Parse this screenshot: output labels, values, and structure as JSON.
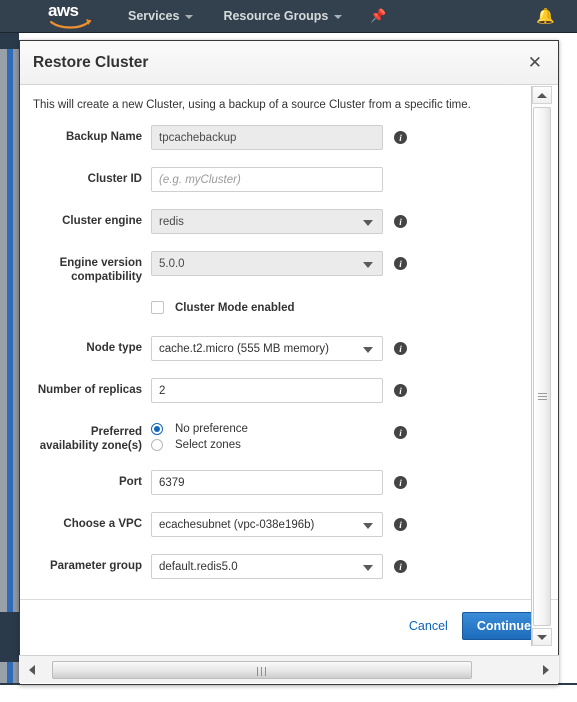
{
  "nav": {
    "logo_text": "aws",
    "logo_name": "aws-logo",
    "services_label": "Services",
    "resource_groups_label": "Resource Groups",
    "pin_icon": "pin-icon",
    "bell_icon": "bell-icon"
  },
  "modal": {
    "title": "Restore Cluster",
    "close_label": "✕",
    "intro": "This will create a new Cluster, using a backup of a source Cluster from a specific time."
  },
  "form": {
    "backup_name": {
      "label": "Backup Name",
      "value": "tpcachebackup",
      "disabled": true
    },
    "cluster_id": {
      "label": "Cluster ID",
      "value": "",
      "placeholder": "(e.g. myCluster)"
    },
    "cluster_engine": {
      "label": "Cluster engine",
      "value": "redis",
      "disabled": true
    },
    "engine_version": {
      "label_line1": "Engine version",
      "label_line2": "compatibility",
      "value": "5.0.0",
      "disabled": true
    },
    "cluster_mode": {
      "label": "Cluster Mode enabled",
      "checked": false
    },
    "node_type": {
      "label": "Node type",
      "value": "cache.t2.micro (555 MB memory)"
    },
    "replicas": {
      "label": "Number of replicas",
      "value": "2"
    },
    "availability_zones": {
      "label_line1": "Preferred",
      "label_line2": "availability zone(s)",
      "option_no_preference": "No preference",
      "option_select_zones": "Select zones",
      "selected": "No preference"
    },
    "port": {
      "label": "Port",
      "value": "6379"
    },
    "vpc": {
      "label": "Choose a VPC",
      "value": "ecachesubnet (vpc-038e196b)"
    },
    "parameter_group": {
      "label": "Parameter group",
      "value": "default.redis5.0"
    },
    "info_icon_char": "i"
  },
  "footer": {
    "cancel_label": "Cancel",
    "continue_label": "Continue"
  },
  "colors": {
    "nav_bg": "#33414f",
    "accent_blue": "#1c6cbb",
    "link_blue": "#0a64b7",
    "radio_blue": "#1166bb",
    "disabled_field": "#ebebeb"
  }
}
